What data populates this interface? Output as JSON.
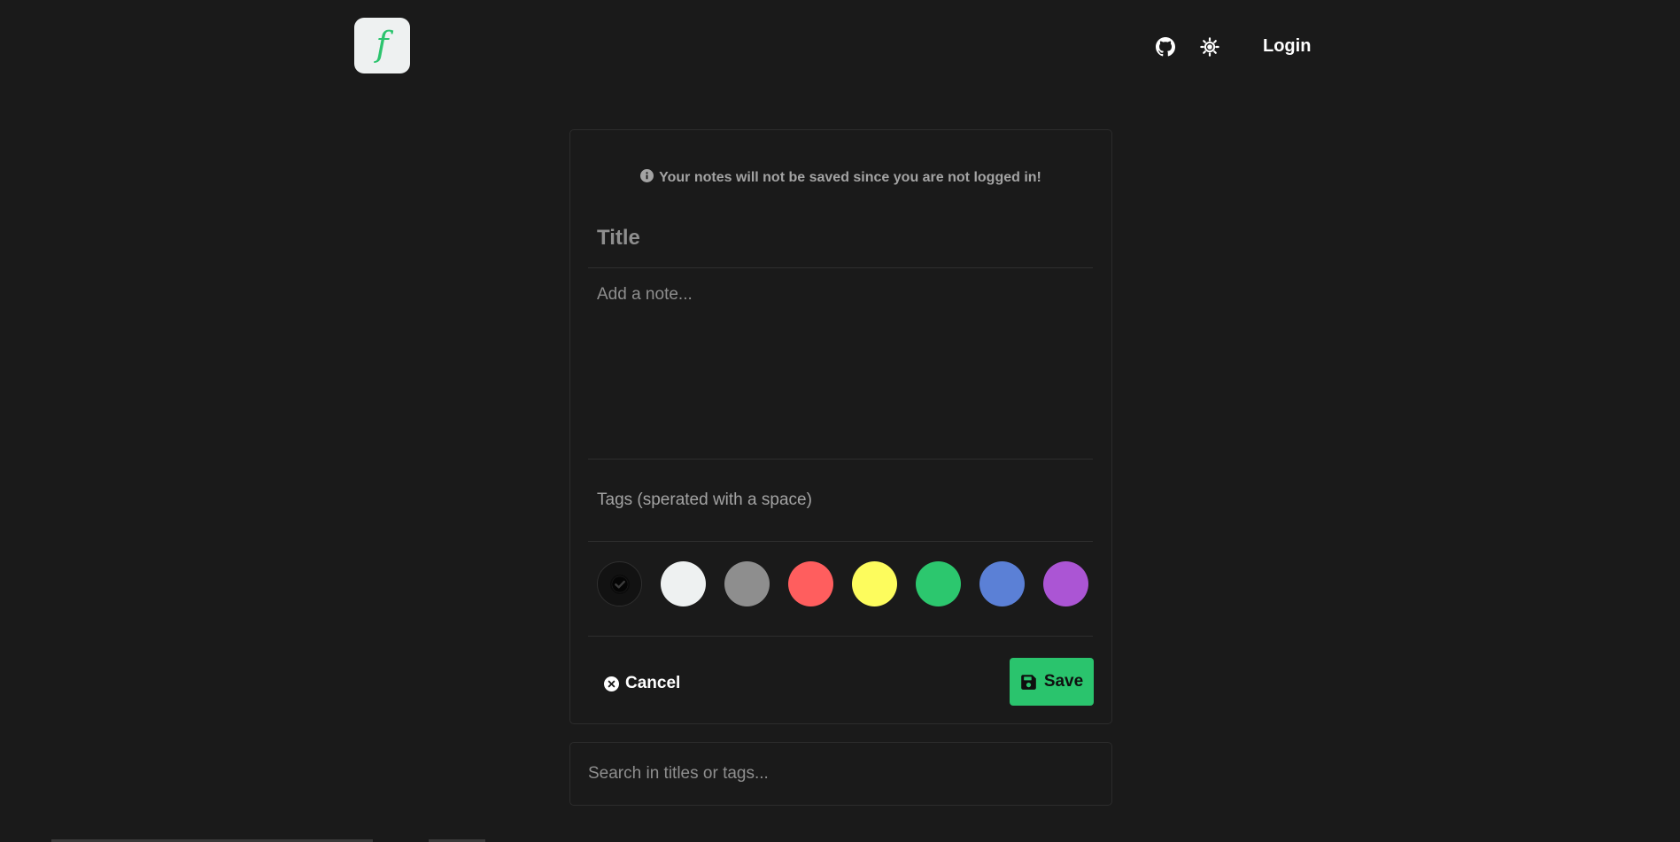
{
  "header": {
    "logo_letter": "f",
    "github_icon": "github-icon",
    "theme_icon": "sun-icon",
    "login_label": "Login"
  },
  "form": {
    "notice": "Your notes will not be saved since you are not logged in!",
    "title_placeholder": "Title",
    "note_placeholder": "Add a note...",
    "tags_placeholder": "Tags (sperated with a space)",
    "colors": [
      {
        "name": "default",
        "hex": "#121212",
        "selected": true
      },
      {
        "name": "white",
        "hex": "#eef1f1",
        "selected": false
      },
      {
        "name": "gray",
        "hex": "#8e8e8e",
        "selected": false
      },
      {
        "name": "red",
        "hex": "#ff5e5e",
        "selected": false
      },
      {
        "name": "yellow",
        "hex": "#fdfc5d",
        "selected": false
      },
      {
        "name": "green",
        "hex": "#2cc76e",
        "selected": false
      },
      {
        "name": "blue",
        "hex": "#5b80d6",
        "selected": false
      },
      {
        "name": "purple",
        "hex": "#ab55d4",
        "selected": false
      }
    ],
    "cancel_label": "Cancel",
    "save_label": "Save"
  },
  "search": {
    "placeholder": "Search in titles or tags..."
  },
  "theme": {
    "background": "#1a1a1a",
    "accent": "#2ac46d"
  }
}
